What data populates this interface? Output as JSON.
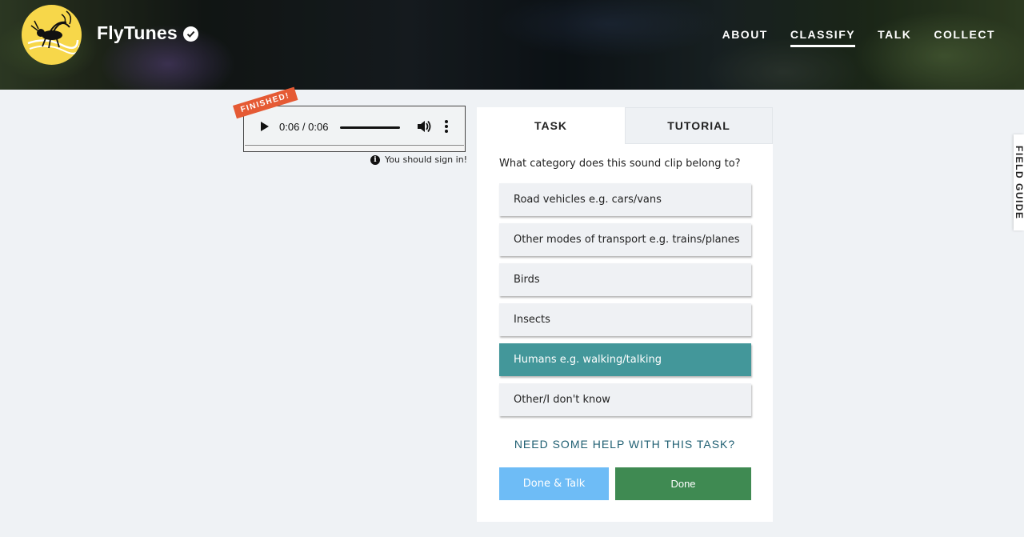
{
  "brand": {
    "name": "FlyTunes"
  },
  "nav": {
    "items": [
      {
        "label": "ABOUT",
        "active": false
      },
      {
        "label": "CLASSIFY",
        "active": true
      },
      {
        "label": "TALK",
        "active": false
      },
      {
        "label": "COLLECT",
        "active": false
      }
    ]
  },
  "audio": {
    "time": "0:06 / 0:06",
    "badge": "FINISHED!",
    "signin_notice": "You should sign in!"
  },
  "tabs": {
    "task": "TASK",
    "tutorial": "TUTORIAL"
  },
  "task": {
    "question": "What category does this sound clip belong to?",
    "answers": [
      {
        "label": "Road vehicles e.g. cars/vans",
        "selected": false
      },
      {
        "label": "Other modes of transport e.g. trains/planes",
        "selected": false
      },
      {
        "label": "Birds",
        "selected": false
      },
      {
        "label": "Insects",
        "selected": false
      },
      {
        "label": "Humans e.g. walking/talking",
        "selected": true
      },
      {
        "label": "Other/I don't know",
        "selected": false
      }
    ],
    "help": "NEED SOME HELP WITH THIS TASK?",
    "done_talk": "Done & Talk",
    "done": "Done"
  },
  "field_guide": "FIELD GUIDE",
  "colors": {
    "selected_answer": "#43979a",
    "done_button": "#3f8a52",
    "done_talk_button": "#6ebcf6",
    "badge": "#e55a34",
    "logo": "#f7d74a"
  }
}
